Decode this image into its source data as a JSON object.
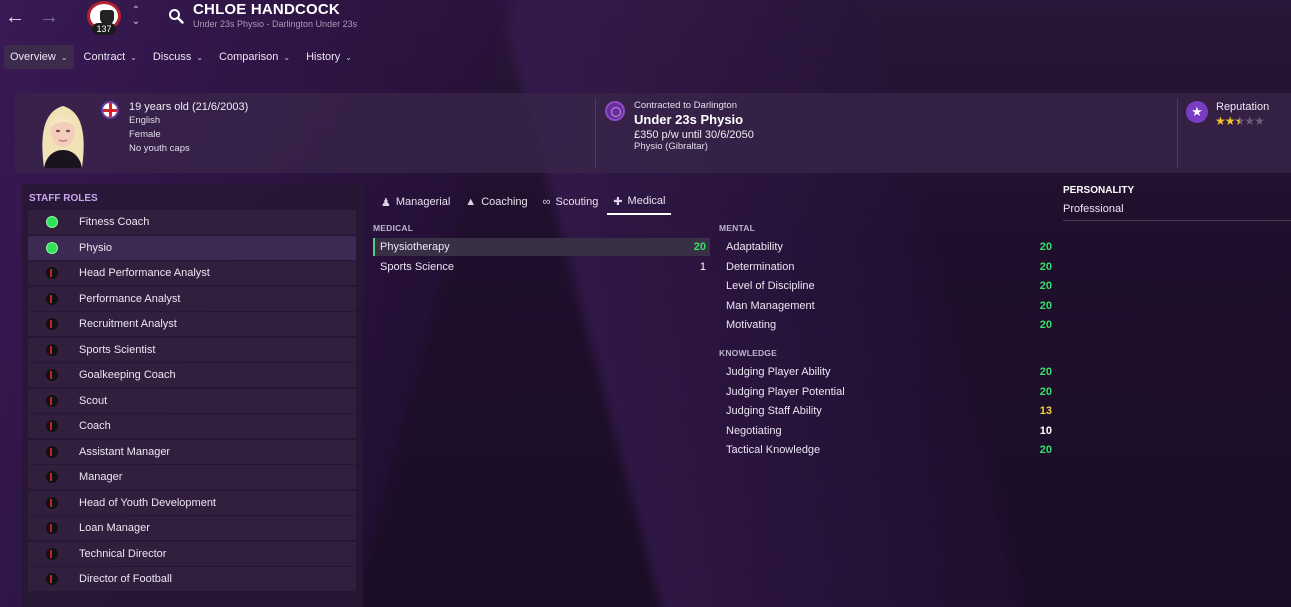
{
  "header": {
    "name": "CHLOE HANDCOCK",
    "subtitle": "Under 23s Physio - Darlington Under 23s",
    "badge_number": "137"
  },
  "tabs": [
    {
      "label": "Overview"
    },
    {
      "label": "Contract"
    },
    {
      "label": "Discuss"
    },
    {
      "label": "Comparison"
    },
    {
      "label": "History"
    }
  ],
  "info": {
    "age": "19 years old (21/6/2003)",
    "nationality": "English",
    "gender": "Female",
    "caps": "No youth caps",
    "contract_label": "Contracted to Darlington",
    "role": "Under 23s Physio",
    "wage": "£350 p/w until 30/6/2050",
    "role_detail": "Physio (Gibraltar)",
    "reputation_label": "Reputation",
    "reputation_stars": 2.5
  },
  "staff_roles": {
    "title": "STAFF ROLES",
    "items": [
      {
        "label": "Fitness Coach",
        "status": "green"
      },
      {
        "label": "Physio",
        "status": "green"
      },
      {
        "label": "Head Performance Analyst",
        "status": "none"
      },
      {
        "label": "Performance Analyst",
        "status": "none"
      },
      {
        "label": "Recruitment Analyst",
        "status": "none"
      },
      {
        "label": "Sports Scientist",
        "status": "none"
      },
      {
        "label": "Goalkeeping Coach",
        "status": "none"
      },
      {
        "label": "Scout",
        "status": "none"
      },
      {
        "label": "Coach",
        "status": "none"
      },
      {
        "label": "Assistant Manager",
        "status": "none"
      },
      {
        "label": "Manager",
        "status": "none"
      },
      {
        "label": "Head of Youth Development",
        "status": "none"
      },
      {
        "label": "Loan Manager",
        "status": "none"
      },
      {
        "label": "Technical Director",
        "status": "none"
      },
      {
        "label": "Director of Football",
        "status": "none"
      }
    ]
  },
  "attr_tabs": [
    {
      "label": "Managerial",
      "icon": "managerial-icon"
    },
    {
      "label": "Coaching",
      "icon": "coaching-icon"
    },
    {
      "label": "Scouting",
      "icon": "binoculars-icon"
    },
    {
      "label": "Medical",
      "icon": "medkit-icon"
    }
  ],
  "medical": {
    "title": "MEDICAL",
    "items": [
      {
        "label": "Physiotherapy",
        "value": "20",
        "color": "green"
      },
      {
        "label": "Sports Science",
        "value": "1",
        "color": "white"
      }
    ]
  },
  "mental": {
    "title": "MENTAL",
    "items": [
      {
        "label": "Adaptability",
        "value": "20",
        "color": "green"
      },
      {
        "label": "Determination",
        "value": "20",
        "color": "green"
      },
      {
        "label": "Level of Discipline",
        "value": "20",
        "color": "green"
      },
      {
        "label": "Man Management",
        "value": "20",
        "color": "green"
      },
      {
        "label": "Motivating",
        "value": "20",
        "color": "green"
      }
    ]
  },
  "knowledge": {
    "title": "KNOWLEDGE",
    "items": [
      {
        "label": "Judging Player Ability",
        "value": "20",
        "color": "green"
      },
      {
        "label": "Judging Player Potential",
        "value": "20",
        "color": "green"
      },
      {
        "label": "Judging Staff Ability",
        "value": "13",
        "color": "yellow"
      },
      {
        "label": "Negotiating",
        "value": "10",
        "color": "white"
      },
      {
        "label": "Tactical Knowledge",
        "value": "20",
        "color": "green"
      }
    ]
  },
  "personality": {
    "title": "PERSONALITY",
    "value": "Professional"
  }
}
